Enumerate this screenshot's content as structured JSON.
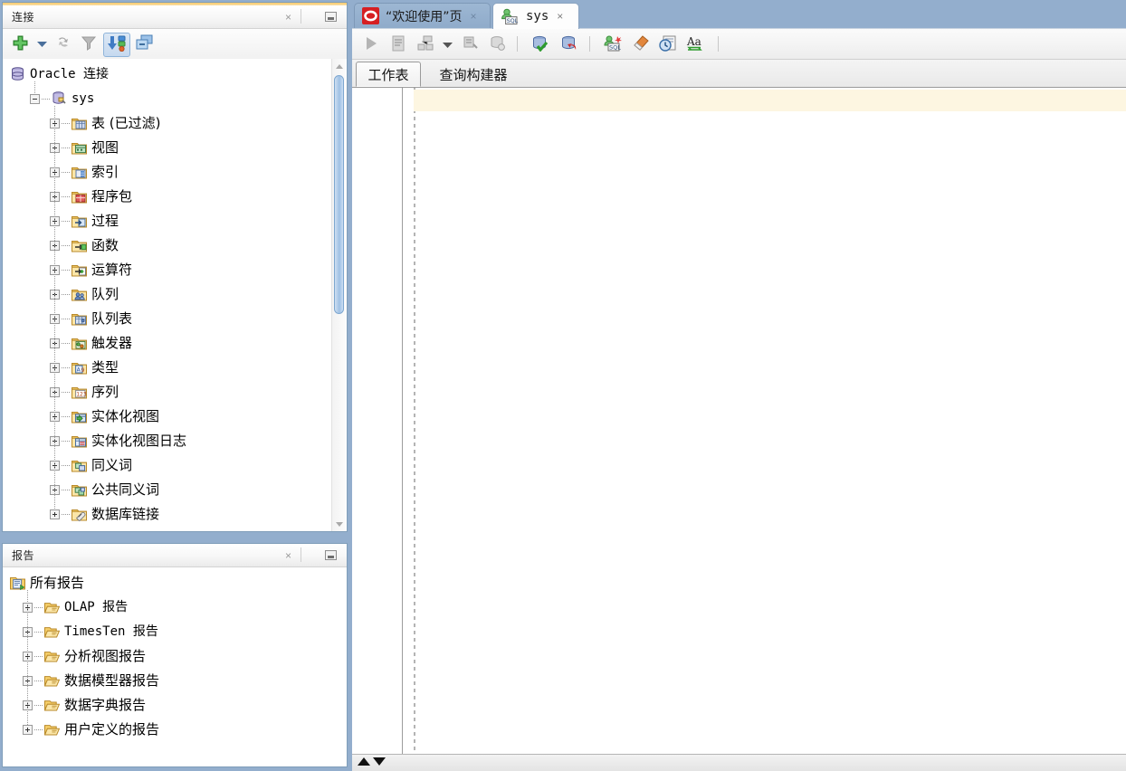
{
  "theme": {
    "window_bg": "#93aecd",
    "panel_border": "#7f9db9",
    "accent_orange": "#f6c969",
    "current_line": "#fdf6e1",
    "tab_active_bg": "#fdfdfd",
    "tab_inactive_bg": "#9db7d3"
  },
  "connections_panel": {
    "title": "连接",
    "close_label": "×",
    "minimize_label": "▭",
    "toolbar": [
      {
        "name": "new-connection-button",
        "icon": "plus-icon",
        "label": "新建连接",
        "state": "enabled"
      },
      {
        "name": "new-connection-dropdown",
        "icon": "chevron-down-icon",
        "label": "下拉",
        "state": "enabled"
      },
      {
        "name": "refresh-button",
        "icon": "refresh-icon",
        "label": "刷新",
        "state": "disabled"
      },
      {
        "name": "filter-button",
        "icon": "filter-icon",
        "label": "过滤",
        "state": "disabled"
      },
      {
        "name": "import-connections-button",
        "icon": "import-status-icon",
        "label": "导入/导出",
        "state": "pressed"
      },
      {
        "name": "collapse-all-button",
        "icon": "collapse-all-icon",
        "label": "全部折叠",
        "state": "enabled"
      }
    ],
    "tree": [
      {
        "label": "Oracle 连接",
        "icon": "database-icon",
        "depth": 0,
        "expander": "none",
        "mono": true
      },
      {
        "label": "sys",
        "icon": "connection-icon",
        "depth": 1,
        "expander": "minus",
        "mono": true
      },
      {
        "label": "表 (已过滤)",
        "icon": "folder-table-icon",
        "depth": 2,
        "expander": "plus",
        "mono": false
      },
      {
        "label": "视图",
        "icon": "folder-view-icon",
        "depth": 2,
        "expander": "plus",
        "mono": false
      },
      {
        "label": "索引",
        "icon": "folder-index-icon",
        "depth": 2,
        "expander": "plus",
        "mono": false
      },
      {
        "label": "程序包",
        "icon": "folder-package-icon",
        "depth": 2,
        "expander": "plus",
        "mono": false
      },
      {
        "label": "过程",
        "icon": "folder-procedure-icon",
        "depth": 2,
        "expander": "plus",
        "mono": false
      },
      {
        "label": "函数",
        "icon": "folder-function-icon",
        "depth": 2,
        "expander": "plus",
        "mono": false
      },
      {
        "label": "运算符",
        "icon": "folder-operator-icon",
        "depth": 2,
        "expander": "plus",
        "mono": false
      },
      {
        "label": "队列",
        "icon": "folder-queue-icon",
        "depth": 2,
        "expander": "plus",
        "mono": false
      },
      {
        "label": "队列表",
        "icon": "folder-queue-table-icon",
        "depth": 2,
        "expander": "plus",
        "mono": false
      },
      {
        "label": "触发器",
        "icon": "folder-trigger-icon",
        "depth": 2,
        "expander": "plus",
        "mono": false
      },
      {
        "label": "类型",
        "icon": "folder-type-icon",
        "depth": 2,
        "expander": "plus",
        "mono": false
      },
      {
        "label": "序列",
        "icon": "folder-sequence-icon",
        "depth": 2,
        "expander": "plus",
        "mono": false
      },
      {
        "label": "实体化视图",
        "icon": "folder-mview-icon",
        "depth": 2,
        "expander": "plus",
        "mono": false
      },
      {
        "label": "实体化视图日志",
        "icon": "folder-mview-log-icon",
        "depth": 2,
        "expander": "plus",
        "mono": false
      },
      {
        "label": "同义词",
        "icon": "folder-synonym-icon",
        "depth": 2,
        "expander": "plus",
        "mono": false
      },
      {
        "label": "公共同义词",
        "icon": "folder-public-synonym-icon",
        "depth": 2,
        "expander": "plus",
        "mono": false
      },
      {
        "label": "数据库链接",
        "icon": "folder-dblink-icon",
        "depth": 2,
        "expander": "plus",
        "mono": false
      }
    ],
    "scrollbar": {
      "up_arrow": "▲",
      "down_arrow": "▼",
      "thumb_top_pct": 4,
      "thumb_height_pct": 52
    }
  },
  "reports_panel": {
    "title": "报告",
    "close_label": "×",
    "minimize_label": "▭",
    "tree": [
      {
        "label": "所有报告",
        "icon": "all-reports-icon",
        "depth": 0,
        "expander": "none",
        "mono": false
      },
      {
        "label": "OLAP 报告",
        "icon": "folder-open-icon",
        "depth": 1,
        "expander": "plus",
        "mono": true
      },
      {
        "label": "TimesTen 报告",
        "icon": "folder-open-icon",
        "depth": 1,
        "expander": "plus",
        "mono": true
      },
      {
        "label": "分析视图报告",
        "icon": "folder-open-icon",
        "depth": 1,
        "expander": "plus",
        "mono": false
      },
      {
        "label": "数据模型器报告",
        "icon": "folder-open-icon",
        "depth": 1,
        "expander": "plus",
        "mono": false
      },
      {
        "label": "数据字典报告",
        "icon": "folder-open-icon",
        "depth": 1,
        "expander": "plus",
        "mono": false
      },
      {
        "label": "用户定义的报告",
        "icon": "folder-open-icon",
        "depth": 1,
        "expander": "plus",
        "mono": false
      }
    ]
  },
  "editor": {
    "tabs": [
      {
        "label": "“欢迎使用”页",
        "icon": "oracle-logo-icon",
        "active": false,
        "close_label": "×",
        "mono": false
      },
      {
        "label": "sys",
        "icon": "sql-worksheet-icon",
        "active": true,
        "close_label": "×",
        "mono": true
      }
    ],
    "toolbar": [
      {
        "name": "run-statement-button",
        "icon": "run-triangle-icon",
        "label": "执行语句",
        "state": "disabled"
      },
      {
        "name": "run-script-button",
        "icon": "run-script-icon",
        "label": "运行脚本",
        "state": "disabled"
      },
      {
        "name": "explain-plan-button",
        "icon": "explain-plan-icon",
        "label": "说明计划",
        "state": "disabled"
      },
      {
        "name": "autotrace-dropdown",
        "icon": "chevron-down-icon",
        "label": "下拉",
        "state": "enabled"
      },
      {
        "name": "autotrace-button",
        "icon": "autotrace-icon",
        "label": "自动跟踪",
        "state": "disabled"
      },
      {
        "name": "sql-history-button",
        "icon": "sql-history-icon",
        "label": "SQL 历史记录",
        "state": "disabled"
      },
      {
        "name": "commit-button",
        "icon": "commit-icon",
        "label": "提交",
        "state": "enabled"
      },
      {
        "name": "rollback-button",
        "icon": "rollback-icon",
        "label": "回退",
        "state": "enabled"
      },
      {
        "name": "unshared-worksheet-button",
        "icon": "unshared-sql-icon",
        "label": "取消共享 SQL 工作表",
        "state": "enabled"
      },
      {
        "name": "clear-button",
        "icon": "eraser-icon",
        "label": "清除",
        "state": "enabled"
      },
      {
        "name": "schedule-button",
        "icon": "schedule-icon",
        "label": "调度",
        "state": "enabled"
      },
      {
        "name": "format-case-button",
        "icon": "font-case-icon",
        "label": "更改大小写",
        "state": "enabled"
      }
    ],
    "subtabs": [
      {
        "label": "工作表",
        "active": true
      },
      {
        "label": "查询构建器",
        "active": false
      }
    ],
    "worksheet": {
      "content": "",
      "current_line_highlight": true
    }
  },
  "statusbar": {
    "scroll_up_label": "▲",
    "scroll_down_label": "▼"
  }
}
